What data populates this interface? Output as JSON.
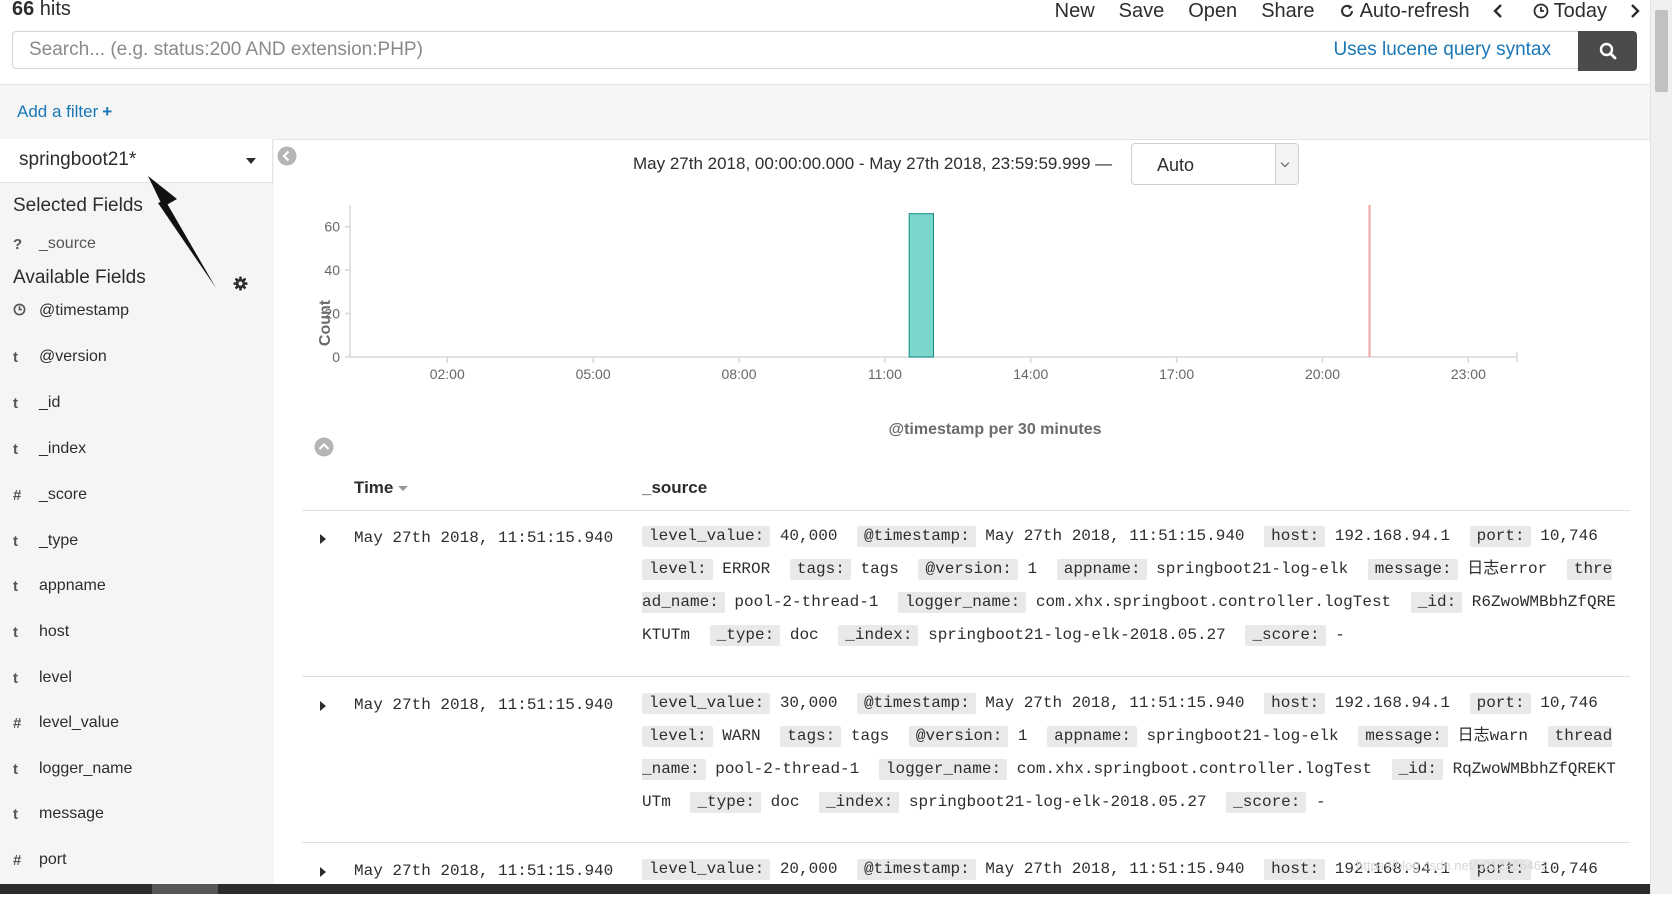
{
  "topbar": {
    "hits_count": "66",
    "hits_label": " hits",
    "menu": {
      "new": "New",
      "save": "Save",
      "open": "Open",
      "share": "Share",
      "auto_refresh": "Auto-refresh",
      "today": "Today"
    }
  },
  "search": {
    "placeholder": "Search... (e.g. status:200 AND extension:PHP)",
    "syntax_link": "Uses lucene query syntax"
  },
  "filter": {
    "add_label": "Add a filter",
    "add_icon": "+"
  },
  "sidebar": {
    "index_pattern": "springboot21*",
    "selected_title": "Selected Fields",
    "selected_fields": [
      {
        "type": "?",
        "name": "_source"
      }
    ],
    "available_title": "Available Fields",
    "available_fields": [
      {
        "type": "clock",
        "name": "@timestamp"
      },
      {
        "type": "t",
        "name": "@version"
      },
      {
        "type": "t",
        "name": "_id"
      },
      {
        "type": "t",
        "name": "_index"
      },
      {
        "type": "#",
        "name": "_score"
      },
      {
        "type": "t",
        "name": "_type"
      },
      {
        "type": "t",
        "name": "appname"
      },
      {
        "type": "t",
        "name": "host"
      },
      {
        "type": "t",
        "name": "level"
      },
      {
        "type": "#",
        "name": "level_value"
      },
      {
        "type": "t",
        "name": "logger_name"
      },
      {
        "type": "t",
        "name": "message"
      },
      {
        "type": "#",
        "name": "port"
      }
    ]
  },
  "histogram": {
    "time_range": "May 27th 2018, 00:00:00.000 - May 27th 2018, 23:59:59.999 —",
    "interval": "Auto"
  },
  "chart_data": {
    "type": "bar",
    "ylabel": "Count",
    "xlabel": "@timestamp per 30 minutes",
    "x_ticks": [
      "02:00",
      "05:00",
      "08:00",
      "11:00",
      "14:00",
      "17:00",
      "20:00",
      "23:00"
    ],
    "y_ticks": [
      0,
      20,
      40,
      60
    ],
    "ylim": [
      0,
      70
    ],
    "xlim_hours": [
      0.0,
      24.0
    ],
    "bars": [
      {
        "start": "11:30",
        "end": "12:00",
        "value": 66
      }
    ],
    "now_marker": "20:58",
    "bar_color": "#7cd6cc",
    "bar_stroke": "#0f8a80",
    "marker_color": "#f0a6a6"
  },
  "table": {
    "headers": {
      "time": "Time",
      "source": "_source"
    },
    "rows": [
      {
        "time": "May 27th 2018, 11:51:15.940",
        "fields": [
          [
            "level_value:",
            "40,000"
          ],
          [
            "@timestamp:",
            "May 27th 2018, 11:51:15.940"
          ],
          [
            "host:",
            "192.168.94.1"
          ],
          [
            "port:",
            "10,746"
          ],
          [
            "level:",
            "ERROR"
          ],
          [
            "tags:",
            "tags"
          ],
          [
            "@version:",
            "1"
          ],
          [
            "appname:",
            "springboot21-log-elk"
          ],
          [
            "message:",
            "日志error"
          ],
          [
            "thread_name:",
            "pool-2-thread-1"
          ],
          [
            "logger_name:",
            "com.xhx.springboot.controller.logTest"
          ],
          [
            "_id:",
            "R6ZwoWMBbhZfQREKTUTm"
          ],
          [
            "_type:",
            "doc"
          ],
          [
            "_index:",
            "springboot21-log-elk-2018.05.27"
          ],
          [
            "_score:",
            " -"
          ]
        ]
      },
      {
        "time": "May 27th 2018, 11:51:15.940",
        "fields": [
          [
            "level_value:",
            "30,000"
          ],
          [
            "@timestamp:",
            "May 27th 2018, 11:51:15.940"
          ],
          [
            "host:",
            "192.168.94.1"
          ],
          [
            "port:",
            "10,746"
          ],
          [
            "level:",
            "WARN"
          ],
          [
            "tags:",
            "tags"
          ],
          [
            "@version:",
            "1"
          ],
          [
            "appname:",
            "springboot21-log-elk"
          ],
          [
            "message:",
            "日志warn"
          ],
          [
            "thread_name:",
            "pool-2-thread-1"
          ],
          [
            "logger_name:",
            "com.xhx.springboot.controller.logTest"
          ],
          [
            "_id:",
            "RqZwoWMBbhZfQREKTUTm"
          ],
          [
            "_type:",
            "doc"
          ],
          [
            "_index:",
            "springboot21-log-elk-2018.05.27"
          ],
          [
            "_score:",
            " -"
          ]
        ]
      },
      {
        "time": "May 27th 2018, 11:51:15.940",
        "fields": [
          [
            "level_value:",
            "20,000"
          ],
          [
            "@timestamp:",
            "May 27th 2018, 11:51:15.940"
          ],
          [
            "host:",
            "192.168.94.1"
          ],
          [
            "port:",
            "10,746"
          ]
        ]
      }
    ]
  },
  "colors": {
    "link": "#1a77b6",
    "search_button": "#4b4b4b",
    "panel_bg": "#f5f5f5"
  },
  "icons": {
    "auto_refresh": "refresh-icon",
    "today": "clock-icon",
    "search": "search-icon",
    "gear": "gear-icon",
    "collapse": "chevron-left-circle-icon",
    "toggle_chart": "chevron-up-circle-icon"
  },
  "watermark": "https://blog.csdn.net/u012326462"
}
